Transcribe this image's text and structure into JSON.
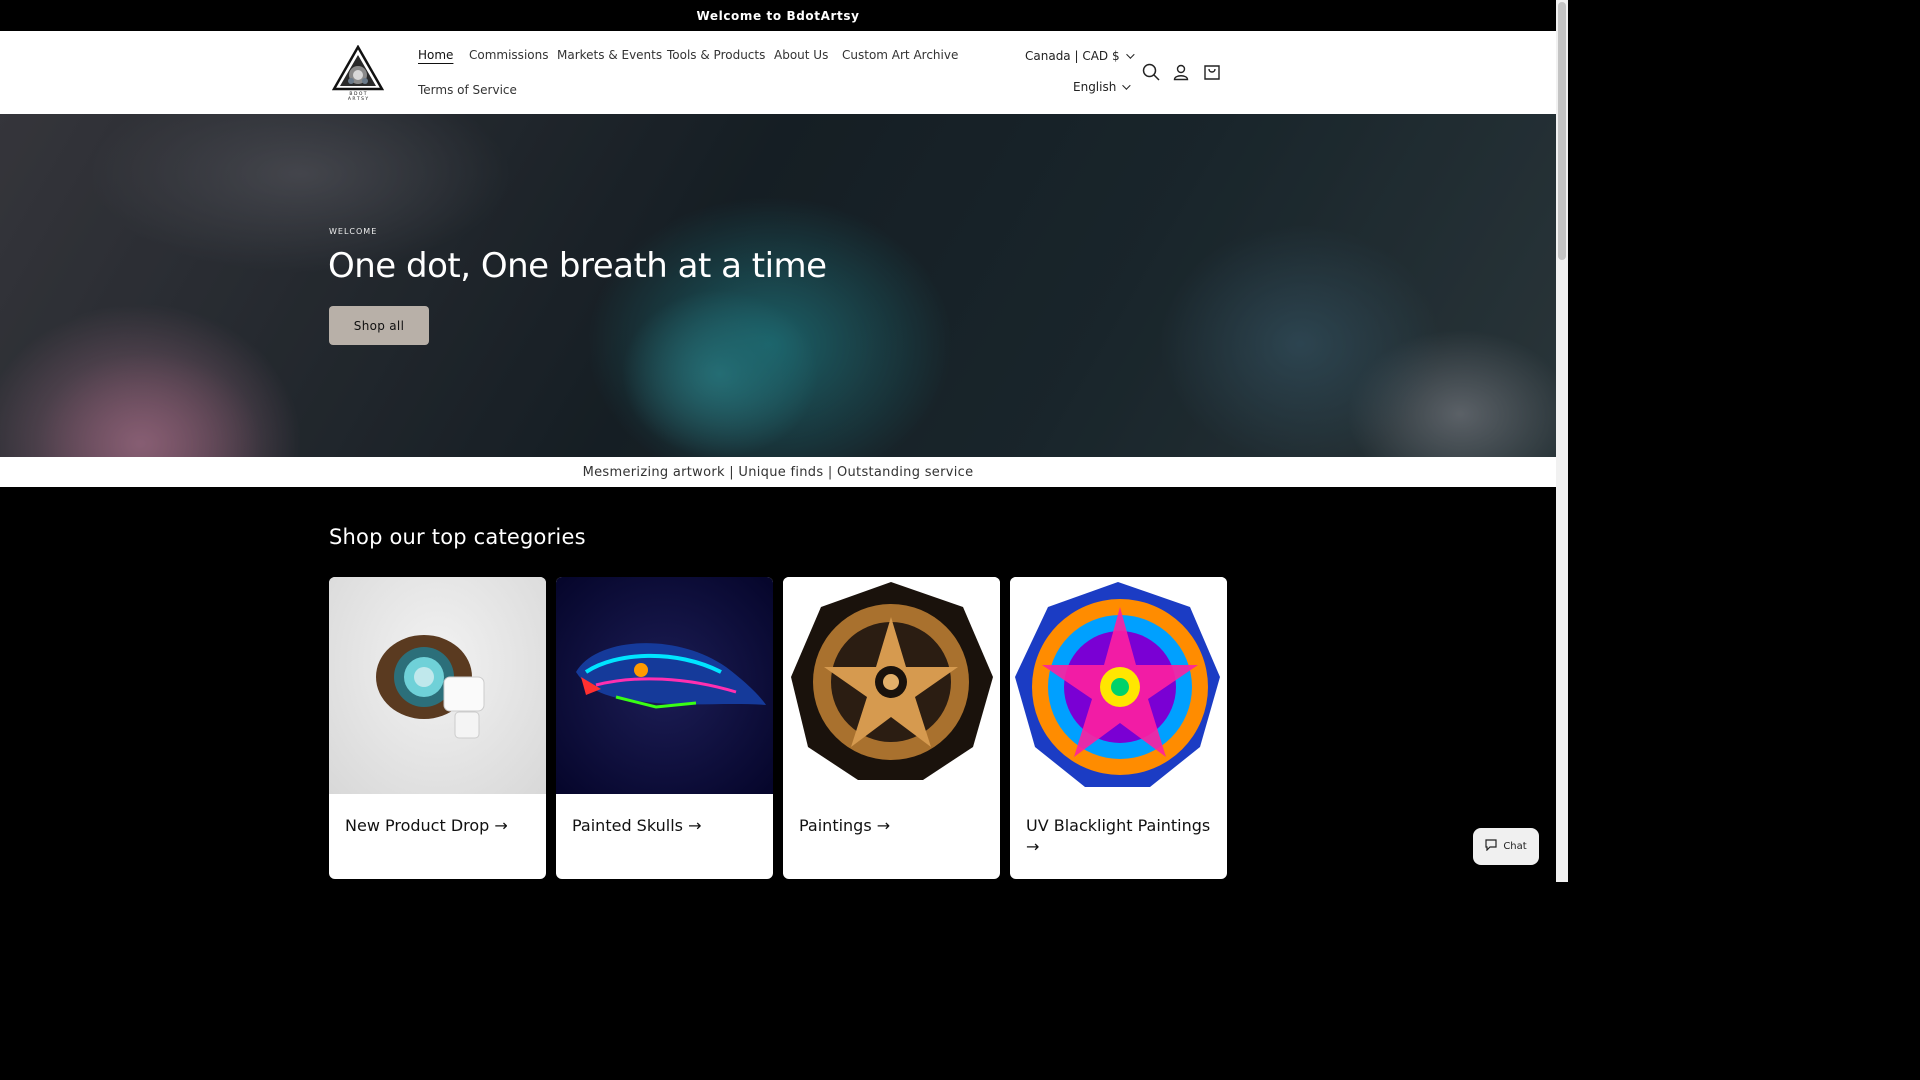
{
  "announcement": "Welcome to BdotArtsy",
  "header": {
    "logo_text": "BDOT ARTSY",
    "nav": [
      {
        "label": "Home"
      },
      {
        "label": "Commissions"
      },
      {
        "label": "Markets & Events"
      },
      {
        "label": "Tools & Products"
      },
      {
        "label": "About Us"
      },
      {
        "label": "Custom Art Archive"
      },
      {
        "label": "Terms of Service"
      }
    ],
    "country": "Canada | CAD $",
    "language": "English"
  },
  "hero": {
    "kicker": "WELCOME",
    "title": "One dot, One breath at a time",
    "button": "Shop all"
  },
  "tagline": "Mesmerizing artwork | Unique finds | Outstanding service",
  "categories": {
    "title": "Shop our top categories",
    "items": [
      {
        "label": "New Product Drop →"
      },
      {
        "label": "Painted Skulls →"
      },
      {
        "label": "Paintings →"
      },
      {
        "label": "UV Blacklight Paintings →"
      }
    ]
  },
  "chat": {
    "label": "Chat"
  },
  "colors": {
    "accent": "#b8b0a8",
    "dark": "#000000"
  }
}
